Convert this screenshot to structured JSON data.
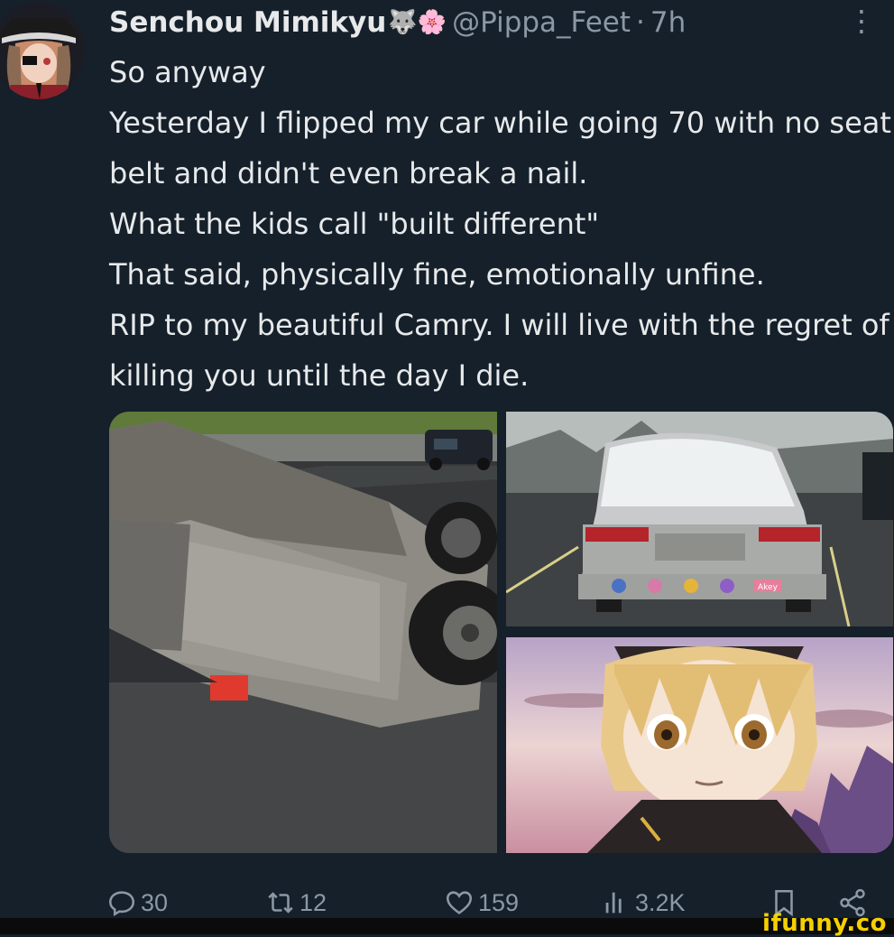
{
  "tweet": {
    "display_name": "Senchou Mimikyu",
    "name_emojis": "🐺🌸",
    "handle": "@Pippa_Feet",
    "separator": "·",
    "time_ago": "7h",
    "more_glyph": "⋮",
    "text": "So anyway\nYesterday I flipped my car while going 70 with no seat belt and didn't even break a nail.\nWhat the kids call \"built different\"\nThat said, physically fine, emotionally unfine.\nRIP to my beautiful Camry. I will live with the regret of killing you until the day I die."
  },
  "media": {
    "plates": [
      "",
      "",
      "Akey"
    ]
  },
  "actions": {
    "replies": "30",
    "retweets": "12",
    "likes": "159",
    "views": "3.2K"
  },
  "watermark": "ifunny.co"
}
